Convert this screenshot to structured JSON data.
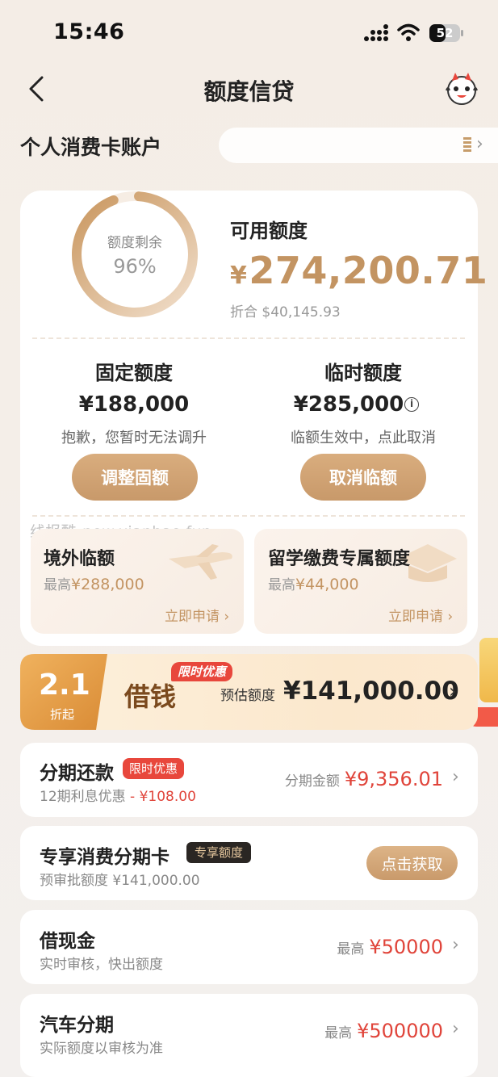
{
  "status_bar": {
    "time": "15:46",
    "battery": "52"
  },
  "header": {
    "title": "额度信贷"
  },
  "account": {
    "title": "个人消费卡账户"
  },
  "summary": {
    "ring_label": "额度剩余",
    "ring_percent": "96%",
    "ring_fraction": 0.96,
    "available_label": "可用额度",
    "available_currency": "¥",
    "available_amount": "274,200.71",
    "converted": "折合  $40,145.93"
  },
  "fixed": {
    "title": "固定额度",
    "amount": "¥188,000",
    "note": "抱歉，您暂时无法调升",
    "button": "调整固额"
  },
  "temp": {
    "title": "临时额度",
    "amount": "¥285,000",
    "note": "临额生效中，点此取消",
    "button": "取消临额"
  },
  "watermark": "线报酷-new.xianbao.fun",
  "mini_cards": [
    {
      "title": "境外临额",
      "sub_prefix": "最高",
      "sub_amount": "¥288,000",
      "link": "立即申请 ›"
    },
    {
      "title": "留学缴费专属额度",
      "sub_prefix": "最高",
      "sub_amount": "¥44,000",
      "link": "立即申请 ›"
    }
  ],
  "loan_banner": {
    "rate": "2.1",
    "rate_sub": "折起",
    "word": "借钱",
    "tag": "限时优惠",
    "est_label": "预估额度",
    "est_amount": "¥141,000.00"
  },
  "rows": {
    "installment": {
      "title": "分期还款",
      "tag": "限时优惠",
      "sub_text": "12期利息优惠 ",
      "sub_red": "- ¥108.00",
      "right_label": "分期金额",
      "right_amount": "¥9,356.01"
    },
    "card": {
      "title": "专享消费分期卡",
      "tag": "专享额度",
      "sub_text": "预审批额度 ¥141,000.00",
      "button": "点击获取"
    },
    "cash": {
      "title": "借现金",
      "sub_text": "实时审核，快出额度",
      "right_label": "最高",
      "right_amount": "¥50000"
    },
    "car": {
      "title": "汽车分期",
      "sub_text": "实际额度以审核为准",
      "right_label": "最高",
      "right_amount": "¥500000"
    }
  },
  "colors": {
    "gold": "#c39462",
    "red": "#e0443a",
    "bg": "#f4ede6"
  }
}
